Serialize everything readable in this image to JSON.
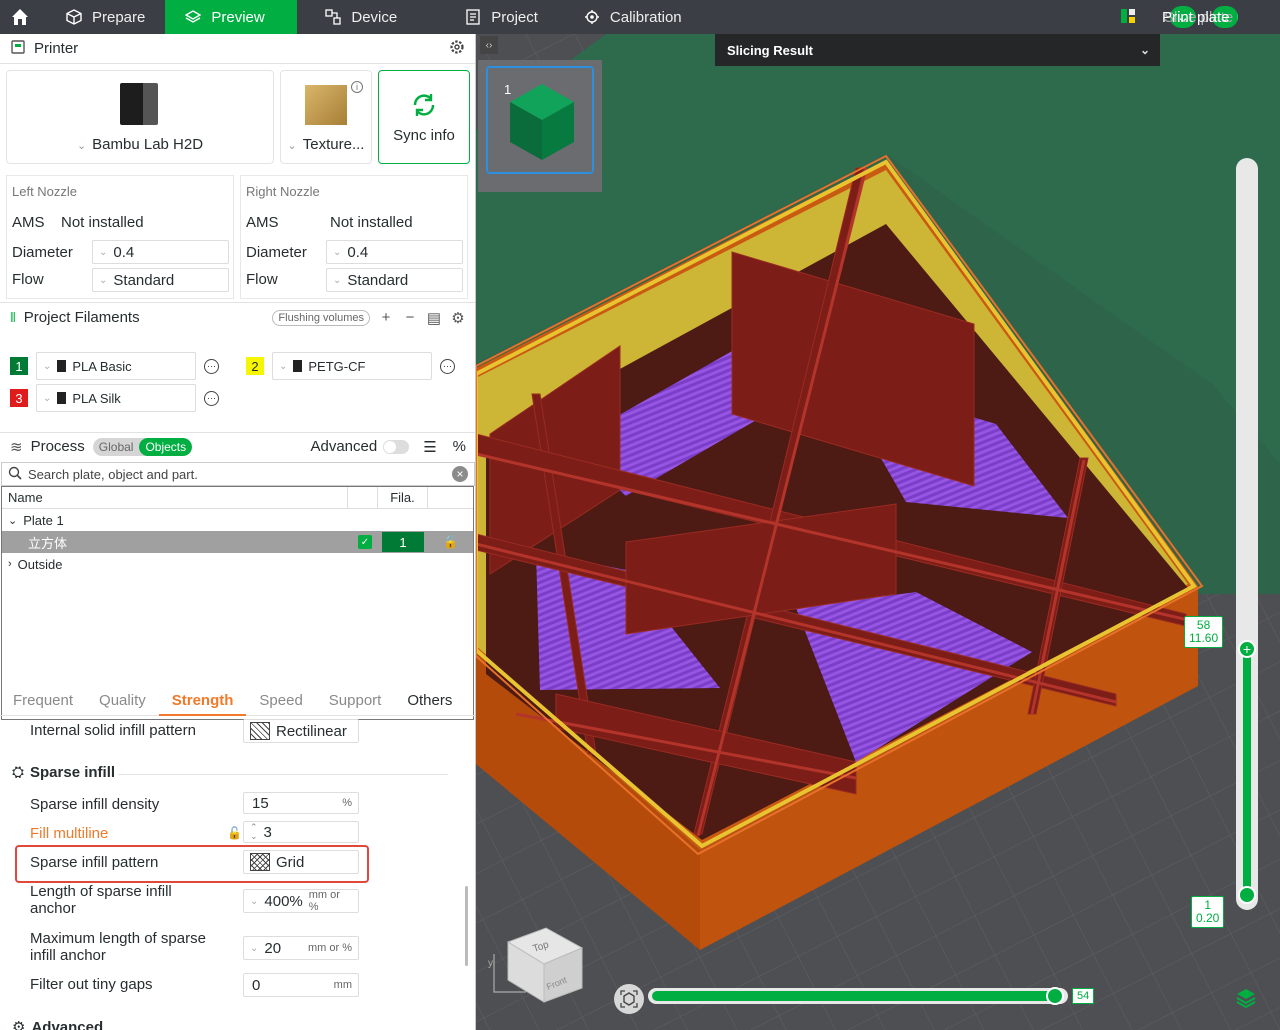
{
  "topbar": {
    "tabs": [
      {
        "label": "Prepare",
        "icon": "cube-outline-icon"
      },
      {
        "label": "Preview",
        "icon": "layers-icon"
      },
      {
        "label": "Device",
        "icon": "device-icon"
      },
      {
        "label": "Project",
        "icon": "project-icon"
      },
      {
        "label": "Calibration",
        "icon": "calibration-icon"
      }
    ],
    "slice_label": "Slice plate",
    "print_label": "Print plate",
    "accent": "#00ae42"
  },
  "printer": {
    "title": "Printer",
    "printer_name": "Bambu Lab H2D",
    "plate_name": "Texture...",
    "sync_label": "Sync info"
  },
  "nozzles": [
    {
      "title": "Left Nozzle",
      "ams_label": "AMS",
      "ams_value": "Not installed",
      "diameter_label": "Diameter",
      "diameter_value": "0.4",
      "flow_label": "Flow",
      "flow_value": "Standard"
    },
    {
      "title": "Right Nozzle",
      "ams_label": "AMS",
      "ams_value": "Not installed",
      "diameter_label": "Diameter",
      "diameter_value": "0.4",
      "flow_label": "Flow",
      "flow_value": "Standard"
    }
  ],
  "filaments": {
    "title": "Project Filaments",
    "flushing_label": "Flushing volumes",
    "items": [
      {
        "num": "1",
        "color": "#007a35",
        "text_color": "#ffffff",
        "name": "PLA Basic"
      },
      {
        "num": "2",
        "color": "#f6f600",
        "text_color": "#262e30",
        "name": "PETG-CF"
      },
      {
        "num": "3",
        "color": "#e01b1b",
        "text_color": "#ffffff",
        "name": "PLA Silk"
      }
    ]
  },
  "process": {
    "title": "Process",
    "global_label": "Global",
    "objects_label": "Objects",
    "advanced_label": "Advanced",
    "search_placeholder": "Search plate, object and part."
  },
  "objects": {
    "col_name": "Name",
    "col_fila": "Fila.",
    "plate_label": "Plate 1",
    "object_name": "立方体",
    "object_fila": "1",
    "outside_label": "Outside"
  },
  "setting_tabs": [
    "Frequent",
    "Quality",
    "Strength",
    "Speed",
    "Support",
    "Others"
  ],
  "settings": {
    "internal_solid_label": "Internal solid infill pattern",
    "internal_solid_value": "Rectilinear",
    "group_title": "Sparse infill",
    "density_label": "Sparse infill density",
    "density_value": "15",
    "density_unit": "%",
    "multiline_label": "Fill multiline",
    "multiline_value": "3",
    "pattern_label": "Sparse infill pattern",
    "pattern_value": "Grid",
    "anchor_label_1": "Length of sparse infill",
    "anchor_label_2": "anchor",
    "anchor_value": "400%",
    "anchor_unit": "mm or %",
    "max_anchor_label_1": "Maximum length of sparse",
    "max_anchor_label_2": "infill anchor",
    "max_anchor_value": "20",
    "max_anchor_unit": "mm or %",
    "gaps_label": "Filter out tiny gaps",
    "gaps_value": "0",
    "gaps_unit": "mm",
    "advanced_group": "Advanced"
  },
  "viewport": {
    "plate_number": "1",
    "slicing_result_label": "Slicing Result",
    "layer_top": "58",
    "height_top": "11.60",
    "layer_bottom": "1",
    "height_bottom": "0.20",
    "moves_value": "54",
    "cube_top": "Top",
    "cube_front": "Front",
    "axis_y": "y"
  }
}
